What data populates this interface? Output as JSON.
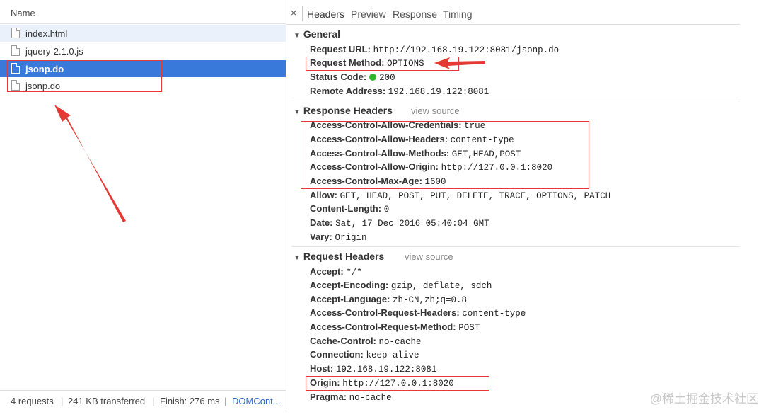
{
  "left_panel": {
    "header": "Name",
    "files": [
      "index.html",
      "jquery-2.1.0.js",
      "jsonp.do",
      "jsonp.do"
    ],
    "selected_index": 2
  },
  "status": {
    "requests": "4 requests",
    "transferred": "241 KB transferred",
    "finish": "Finish: 276 ms",
    "dom": "DOMCont..."
  },
  "tabs": {
    "close": "×",
    "items": [
      "Headers",
      "Preview",
      "Response",
      "Timing"
    ]
  },
  "general": {
    "title": "General",
    "rows": [
      {
        "k": "Request URL:",
        "v": "http://192.168.19.122:8081/jsonp.do"
      },
      {
        "k": "Request Method:",
        "v": "OPTIONS"
      },
      {
        "k": "Status Code:",
        "v": "200"
      },
      {
        "k": "Remote Address:",
        "v": "192.168.19.122:8081"
      }
    ]
  },
  "response_headers": {
    "title": "Response Headers",
    "view_source": "view source",
    "rows": [
      {
        "k": "Access-Control-Allow-Credentials:",
        "v": "true"
      },
      {
        "k": "Access-Control-Allow-Headers:",
        "v": "content-type"
      },
      {
        "k": "Access-Control-Allow-Methods:",
        "v": "GET,HEAD,POST"
      },
      {
        "k": "Access-Control-Allow-Origin:",
        "v": "http://127.0.0.1:8020"
      },
      {
        "k": "Access-Control-Max-Age:",
        "v": "1600"
      },
      {
        "k": "Allow:",
        "v": "GET, HEAD, POST, PUT, DELETE, TRACE, OPTIONS, PATCH"
      },
      {
        "k": "Content-Length:",
        "v": "0"
      },
      {
        "k": "Date:",
        "v": "Sat, 17 Dec 2016 05:40:04 GMT"
      },
      {
        "k": "Vary:",
        "v": "Origin"
      }
    ]
  },
  "request_headers": {
    "title": "Request Headers",
    "view_source": "view source",
    "rows": [
      {
        "k": "Accept:",
        "v": "*/*"
      },
      {
        "k": "Accept-Encoding:",
        "v": "gzip, deflate, sdch"
      },
      {
        "k": "Accept-Language:",
        "v": "zh-CN,zh;q=0.8"
      },
      {
        "k": "Access-Control-Request-Headers:",
        "v": "content-type"
      },
      {
        "k": "Access-Control-Request-Method:",
        "v": "POST"
      },
      {
        "k": "Cache-Control:",
        "v": "no-cache"
      },
      {
        "k": "Connection:",
        "v": "keep-alive"
      },
      {
        "k": "Host:",
        "v": "192.168.19.122:8081"
      },
      {
        "k": "Origin:",
        "v": "http://127.0.0.1:8020"
      },
      {
        "k": "Pragma:",
        "v": "no-cache"
      }
    ]
  },
  "watermark": "@稀土掘金技术社区",
  "colors": {
    "selection": "#3879d9",
    "annotation": "#e53935",
    "status_ok": "#2eb82e",
    "link": "#2a62c9"
  },
  "icons": {
    "file": "file-icon",
    "close": "close-icon",
    "status": "green-status-dot-icon",
    "triangle": "expand-triangle-icon"
  }
}
